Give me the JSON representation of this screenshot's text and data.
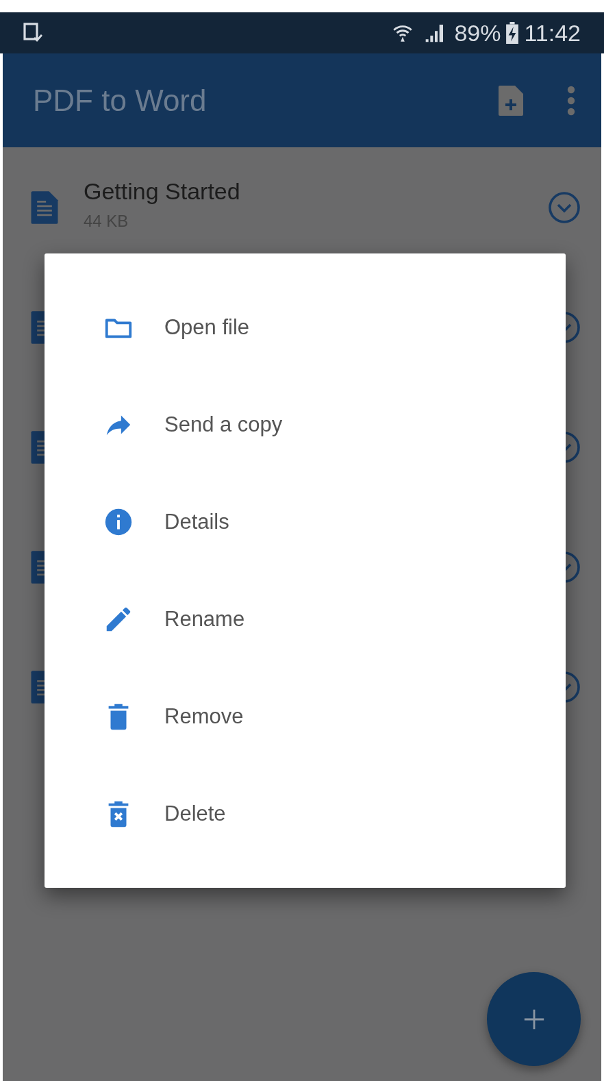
{
  "status_bar": {
    "battery": "89%",
    "time": "11:42"
  },
  "app_bar": {
    "title": "PDF to Word"
  },
  "files": [
    {
      "name": "Getting Started",
      "size": "44 KB"
    }
  ],
  "menu": [
    {
      "label": "Open file",
      "kind": "folder"
    },
    {
      "label": "Send a copy",
      "kind": "share"
    },
    {
      "label": "Details",
      "kind": "info"
    },
    {
      "label": "Rename",
      "kind": "pencil"
    },
    {
      "label": "Remove",
      "kind": "trash"
    },
    {
      "label": "Delete",
      "kind": "delete"
    }
  ]
}
